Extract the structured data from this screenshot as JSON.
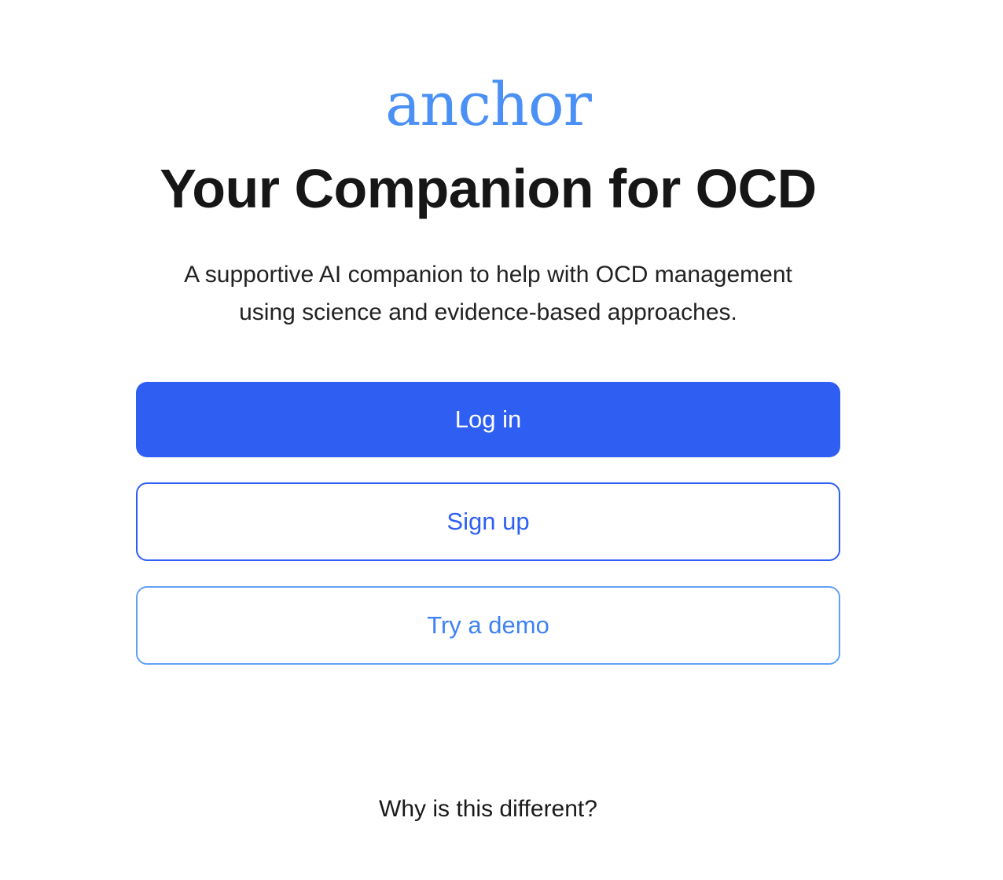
{
  "brand": {
    "logo_text": "anchor",
    "accent": "#4a90f5",
    "primary": "#2e5ff2"
  },
  "hero": {
    "title": "Your Companion for OCD",
    "subtitle_line1": "A supportive AI companion to help with OCD management",
    "subtitle_line2": "using science and evidence-based approaches."
  },
  "actions": {
    "login": "Log in",
    "signup": "Sign up",
    "demo": "Try a demo"
  },
  "footer": {
    "why_link": "Why is this different?"
  }
}
